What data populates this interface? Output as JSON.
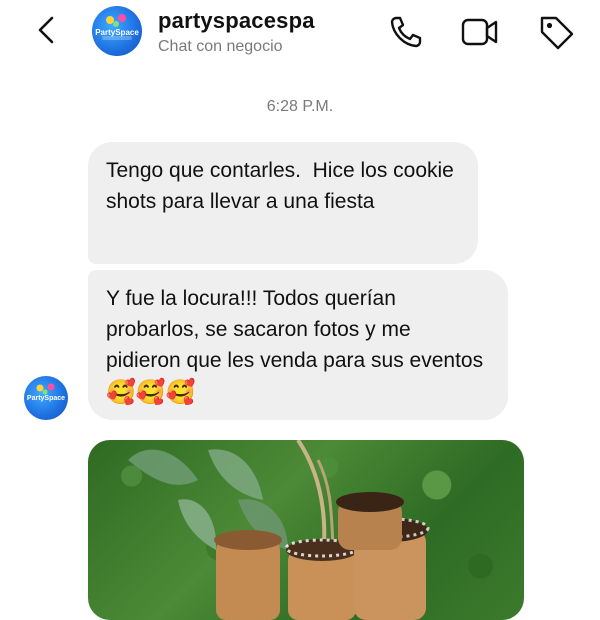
{
  "header": {
    "title": "partyspacespa",
    "subtitle": "Chat con negocio",
    "icons": [
      "back-arrow-icon",
      "phone-icon",
      "video-icon",
      "tag-icon"
    ]
  },
  "avatar": {
    "logo_text": "PartySpace"
  },
  "messages": [
    {
      "timestamp": "6:28 P.M."
    },
    {
      "text": "Tengo que contarles.  Hice los cookie shots para llevar a una fiesta"
    },
    {
      "text": "Y fue la locura!!! Todos querían probarlos, se sacaron fotos y me pidieron que les venda para sus eventos",
      "emojis": "🥰🥰🥰"
    }
  ],
  "colors": {
    "bubble": "#efefef",
    "muted_text": "#7a7a7a",
    "text": "#111111",
    "avatar": "#1d6fe0"
  }
}
